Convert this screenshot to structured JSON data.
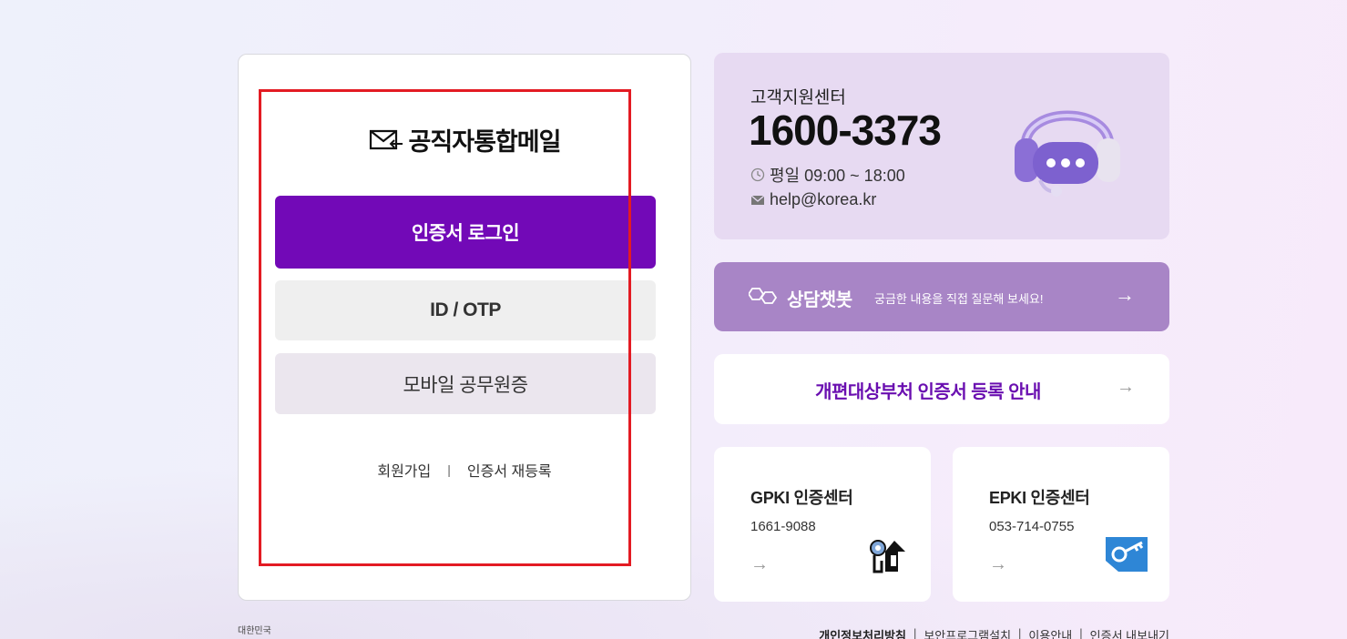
{
  "login": {
    "brand": "공직자통합메일",
    "cert_login": "인증서 로그인",
    "id_otp": "ID / OTP",
    "mobile_id": "모바일 공무원증",
    "signup": "회원가입",
    "separator": "|",
    "cert_reregister": "인증서 재등록"
  },
  "support": {
    "label": "고객지원센터",
    "phone": "1600-3373",
    "hours": "평일 09:00 ~ 18:00",
    "email": "help@korea.kr"
  },
  "chatbot": {
    "title": "상담챗봇",
    "desc": "궁금한 내용을 직접 질문해 보세요!",
    "arrow": "→"
  },
  "notice": {
    "title": "개편대상부처 인증서 등록 안내",
    "arrow": "→"
  },
  "gpki": {
    "title": "GPKI 인증센터",
    "tel": "1661-9088",
    "arrow": "→"
  },
  "epki": {
    "title": "EPKI 인증센터",
    "tel": "053-714-0755",
    "arrow": "→"
  },
  "footer": {
    "logo_text": "대한민국",
    "privacy": "개인정보처리방침",
    "security": "보안프로그램설치",
    "usage": "이용안내",
    "export": "인증서 내보내기",
    "sep": "|"
  },
  "colors": {
    "primary": "#7209b7",
    "chatbot_bg": "#a885c6",
    "support_bg": "#e7daf2",
    "highlight": "#e31b23"
  }
}
